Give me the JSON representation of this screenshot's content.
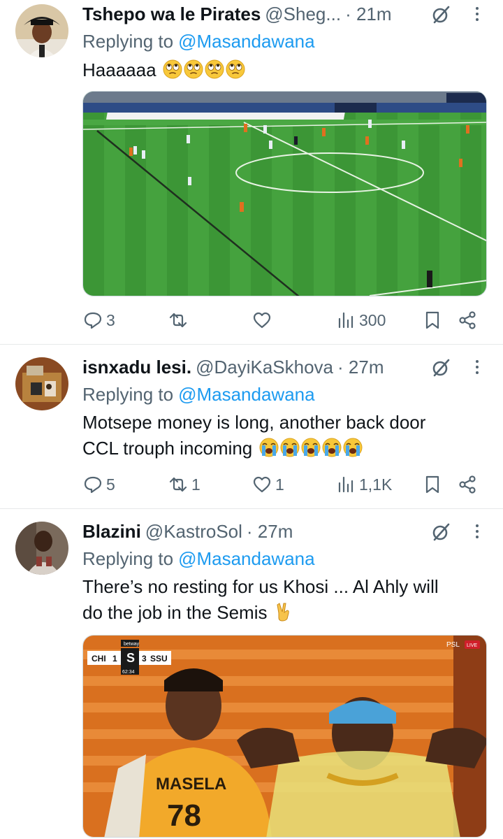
{
  "tweets": [
    {
      "display_name": "Tshepo wa le Pirates",
      "handle": "@Sheg...",
      "time": "· 21m",
      "replying_to_label": "Replying to",
      "replying_to_handle": "@Masandawana",
      "text": "Haaaaaa",
      "emoji_icon": "face-with-rolling-eyes-icon",
      "emoji_count": 4,
      "media": "soccer-match-broadcast-image",
      "stats": {
        "replies": "3",
        "reposts": "",
        "likes": "",
        "views": "300"
      }
    },
    {
      "display_name": "isnxadu lesi.",
      "handle": "@DayiKaSkhova",
      "time": "· 27m",
      "replying_to_label": "Replying to",
      "replying_to_handle": "@Masandawana",
      "text_line1": "Motsepe money is long, another back door",
      "text_line2": "CCL trouph incoming",
      "emoji_icon": "loudly-crying-face-icon",
      "emoji_count": 5,
      "stats": {
        "replies": "5",
        "reposts": "1",
        "likes": "1",
        "views": "1,1K"
      }
    },
    {
      "display_name": "Blazini",
      "handle": "@KastroSol",
      "time": "· 27m",
      "replying_to_label": "Replying to",
      "replying_to_handle": "@Masandawana",
      "text_line1": "There’s no resting for us Khosi ... Al Ahly will",
      "text_line2": "do the job in the Semis",
      "emoji_icon": "victory-hand-icon",
      "media": "stadium-fans-image",
      "scoreboard": {
        "sponsor": "betway",
        "home": "CHI",
        "home_score": "1",
        "away_score": "3",
        "away": "SSU",
        "clock": "62:34",
        "channel": "PSL",
        "live": "LIVE"
      },
      "shirt_name": "MASELA",
      "shirt_number": "78"
    }
  ],
  "colors": {
    "text": "#0f1419",
    "secondary": "#536471",
    "link": "#1d9bf0",
    "divider": "#e7e9ea",
    "pitch": "#3f9a3a"
  }
}
